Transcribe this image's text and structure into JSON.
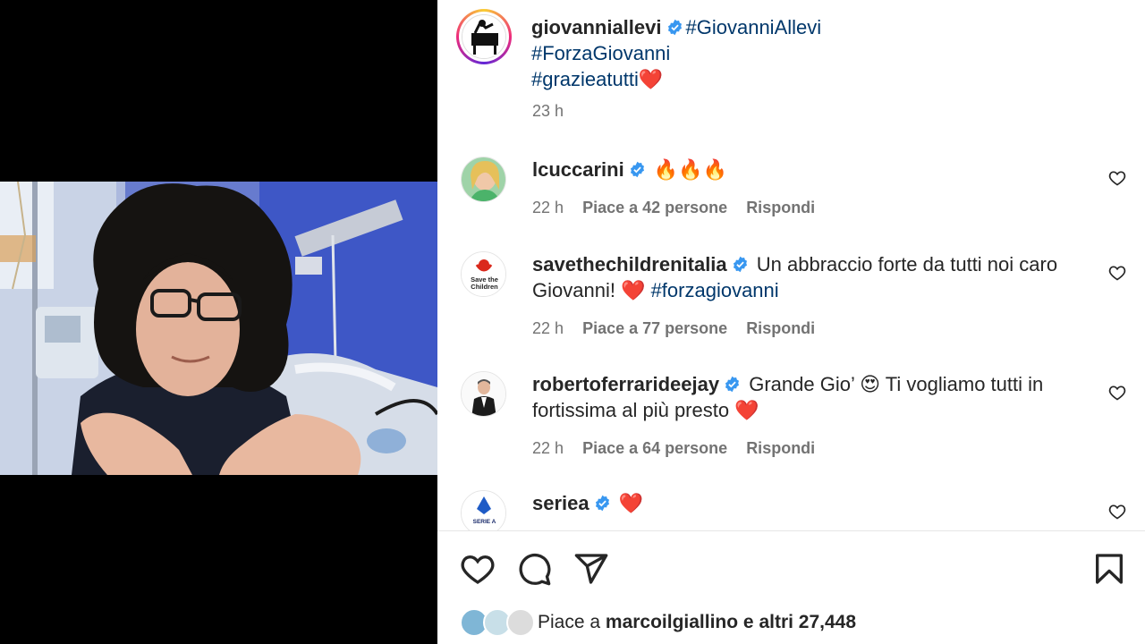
{
  "post": {
    "author": "giovanniallevi",
    "caption_tags": [
      "#GiovanniAllevi",
      "#ForzaGiovanni",
      "#grazieatutti"
    ],
    "heart_emoji": "❤️",
    "time": "23 h"
  },
  "comments": [
    {
      "user": "lcuccarini",
      "text": "🔥🔥🔥",
      "time": "22 h",
      "likes": "Piace a 42 persone",
      "reply": "Rispondi"
    },
    {
      "user": "savethechildrenitalia",
      "text_1": "Un abbraccio forte da tutti noi caro",
      "text_2": "Giovanni! ❤️ ",
      "tag": "#forzagiovanni",
      "time": "22 h",
      "likes": "Piace a 77 persone",
      "reply": "Rispondi",
      "avatar_text_1": "Save the",
      "avatar_text_2": "Children"
    },
    {
      "user": "robertoferrarideejay",
      "text_1": "Grande Gio’ 😍 Ti vogliamo tutti in",
      "text_2": "fortissima al più presto ❤️",
      "time": "22 h",
      "likes": "Piace a 64 persone",
      "reply": "Rispondi"
    },
    {
      "user": "seriea",
      "text": "❤️",
      "avatar_text": "SERIE A"
    }
  ],
  "footer": {
    "likes_prefix": "Piace a ",
    "likes_user": "marcoilgiallino",
    "likes_suffix": " e altri 27,448"
  },
  "icons": [
    "heart-icon",
    "comment-icon",
    "share-icon",
    "bookmark-icon",
    "verified-icon"
  ],
  "colors": {
    "verified": "#3897f0",
    "hashtag": "#00376b",
    "meta": "#737373",
    "heart_red": "#ed4956"
  }
}
